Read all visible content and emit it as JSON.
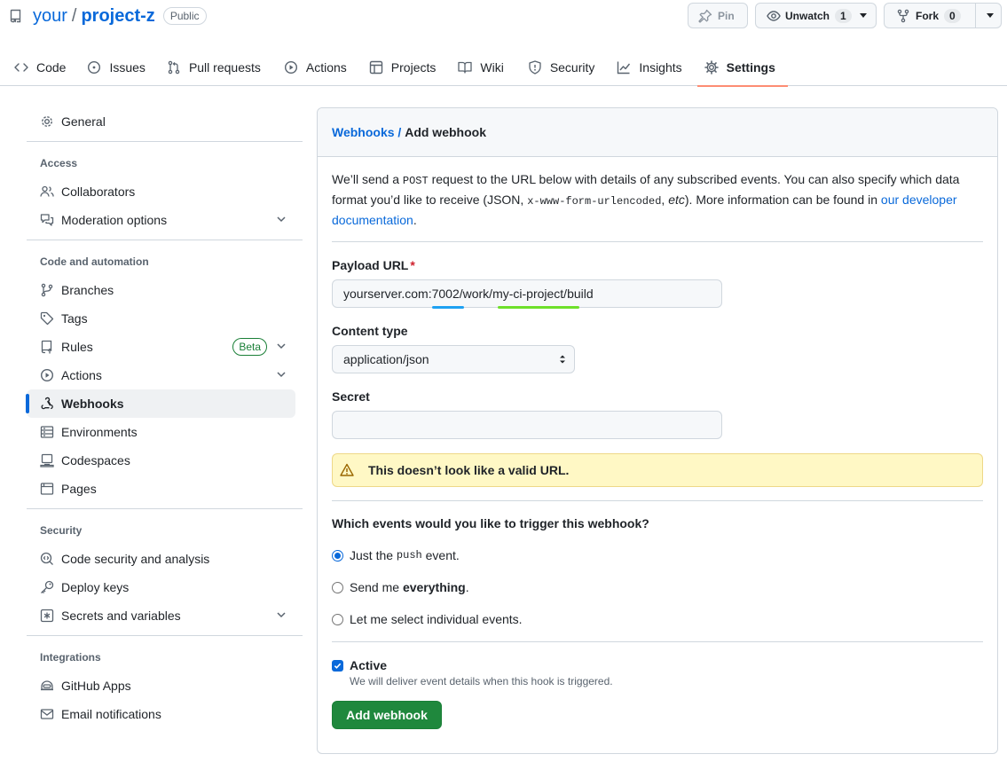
{
  "repo": {
    "owner": "your",
    "separator": "/",
    "name": "project-z",
    "visibility": "Public"
  },
  "actions": {
    "pin_label": "Pin",
    "unwatch_label": "Unwatch",
    "unwatch_count": "1",
    "fork_label": "Fork",
    "fork_count": "0"
  },
  "tabs": [
    {
      "label": "Code",
      "icon": "code-icon"
    },
    {
      "label": "Issues",
      "icon": "issue-icon"
    },
    {
      "label": "Pull requests",
      "icon": "pull-request-icon"
    },
    {
      "label": "Actions",
      "icon": "play-icon"
    },
    {
      "label": "Projects",
      "icon": "table-icon"
    },
    {
      "label": "Wiki",
      "icon": "book-icon"
    },
    {
      "label": "Security",
      "icon": "shield-icon"
    },
    {
      "label": "Insights",
      "icon": "graph-icon"
    },
    {
      "label": "Settings",
      "icon": "gear-icon",
      "selected": true
    }
  ],
  "sidebar": {
    "general": "General",
    "access_heading": "Access",
    "access": [
      "Collaborators",
      "Moderation options"
    ],
    "code_heading": "Code and automation",
    "code": [
      "Branches",
      "Tags",
      "Rules",
      "Actions",
      "Webhooks",
      "Environments",
      "Codespaces",
      "Pages"
    ],
    "rules_badge": "Beta",
    "security_heading": "Security",
    "security": [
      "Code security and analysis",
      "Deploy keys",
      "Secrets and variables"
    ],
    "integrations_heading": "Integrations",
    "integrations": [
      "GitHub Apps",
      "Email notifications"
    ]
  },
  "panel": {
    "breadcrumb_link": "Webhooks",
    "breadcrumb_sep": " / ",
    "breadcrumb_current": "Add webhook",
    "intro": {
      "p1": "We’ll send a ",
      "code1": "POST",
      "p2": " request to the URL below with details of any subscribed events. You can also specify which data format you’d like to receive (JSON, ",
      "code2": "x-www-form-urlencoded",
      "p3": ", ",
      "em": "etc",
      "p4": "). More information can be found in ",
      "link": "our developer documentation",
      "p5": "."
    },
    "payload_label": "Payload URL",
    "payload_required": "*",
    "payload_value": "yourserver.com:7002/work/my-ci-project/build",
    "content_type_label": "Content type",
    "content_type_value": "application/json",
    "secret_label": "Secret",
    "secret_value": "",
    "warning": "This doesn’t look like a valid URL.",
    "events_question": "Which events would you like to trigger this webhook?",
    "event_options": {
      "push_a": "Just the ",
      "push_code": "push",
      "push_b": " event.",
      "everything_a": "Send me ",
      "everything_b": "everything",
      "everything_c": ".",
      "individual": "Let me select individual events."
    },
    "active_label": "Active",
    "active_hint": "We will deliver event details when this hook is triggered.",
    "submit_label": "Add webhook"
  },
  "colors": {
    "accent": "#0969da",
    "primary_button": "#1f883d",
    "warning_bg": "#fff8c5",
    "tab_underline": "#fd8c73",
    "underline_blue": "#1ea1f2",
    "underline_green": "#6ee02a"
  }
}
